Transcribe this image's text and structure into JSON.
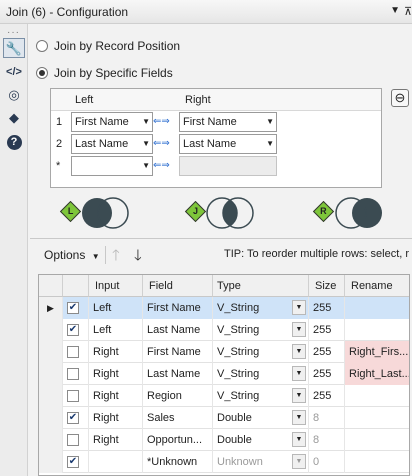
{
  "window": {
    "title": "Join (6) - Configuration"
  },
  "toolbar_icons": [
    "wrench-icon",
    "code-icon",
    "network-icon",
    "tag-icon",
    "help-icon"
  ],
  "join_mode": {
    "by_position": "Join by Record Position",
    "by_fields": "Join by Specific Fields"
  },
  "field_grid": {
    "header_left": "Left",
    "header_right": "Right",
    "rows": [
      {
        "num": "1",
        "left": "First Name",
        "right": "First Name"
      },
      {
        "num": "2",
        "left": "Last Name",
        "right": "Last Name"
      },
      {
        "num": "*",
        "left": "",
        "right": ""
      }
    ]
  },
  "outputs": [
    "L",
    "J",
    "R"
  ],
  "options": {
    "label": "Options",
    "tip": "TIP: To reorder multiple rows: select, r"
  },
  "table": {
    "columns": [
      "Input",
      "Field",
      "Type",
      "Size",
      "Rename"
    ],
    "rows": [
      {
        "input": "Left",
        "field": "First Name",
        "type": "V_String",
        "size": "255",
        "rename": "",
        "checked": true,
        "highlight": true
      },
      {
        "input": "Left",
        "field": "Last Name",
        "type": "V_String",
        "size": "255",
        "rename": "",
        "checked": true,
        "highlight": false
      },
      {
        "input": "Right",
        "field": "First Name",
        "type": "V_String",
        "size": "255",
        "rename": "Right_Firs...",
        "checked": false,
        "highlight": false
      },
      {
        "input": "Right",
        "field": "Last Name",
        "type": "V_String",
        "size": "255",
        "rename": "Right_Last...",
        "checked": false,
        "highlight": false
      },
      {
        "input": "Right",
        "field": "Region",
        "type": "V_String",
        "size": "255",
        "rename": "",
        "checked": false,
        "highlight": false
      },
      {
        "input": "Right",
        "field": "Sales",
        "type": "Double",
        "size": "8",
        "rename": "",
        "checked": true,
        "highlight": false
      },
      {
        "input": "Right",
        "field": "Opportun...",
        "type": "Double",
        "size": "8",
        "rename": "",
        "checked": false,
        "highlight": false
      },
      {
        "input": "",
        "field": "*Unknown",
        "type": "Unknown",
        "size": "0",
        "rename": "",
        "checked": true,
        "highlight": false
      }
    ]
  }
}
